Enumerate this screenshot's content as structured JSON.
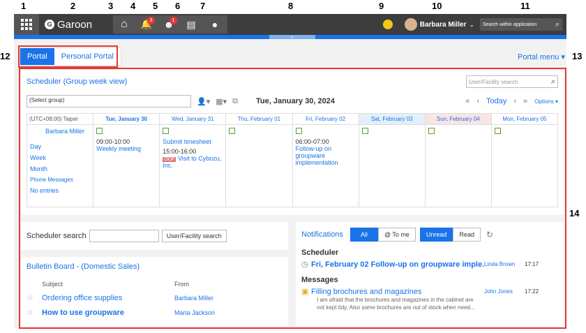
{
  "callouts": [
    "1",
    "2",
    "3",
    "4",
    "5",
    "6",
    "7",
    "8",
    "9",
    "10",
    "11",
    "12",
    "13",
    "14"
  ],
  "topbar": {
    "logo": "Garoon",
    "notify_badge": "3",
    "presence_badge": "1",
    "user_name": "Barbara Miller",
    "search_label": "Search within application"
  },
  "tabs": [
    {
      "label": "Portal"
    },
    {
      "label": "Personal Portal"
    }
  ],
  "portal_menu": "Portal menu",
  "scheduler": {
    "title": "Scheduler (Group week view)",
    "facility_placeholder": "User/Facility search",
    "group_select": "(Select group)",
    "date": "Tue, January 30, 2024",
    "today": "Today",
    "options": "Options",
    "timezone": "(UTC+08:00) Taipei",
    "days": [
      "Tue, January 30",
      "Wed, January 31",
      "Thu, February 01",
      "Fri, February 02",
      "Sat, February 03",
      "Sun, February 04",
      "Mon, February 05"
    ],
    "user": "Barbara Miller",
    "views": [
      "Day",
      "Week",
      "Month",
      "Phone Messages",
      "No entries"
    ],
    "ev1_time": "09:00-10:00",
    "ev1_title": "Weekly meeting",
    "ev2_title": "Submit timesheet",
    "ev3_time": "15:00-16:00",
    "ev3_badge": "OOF",
    "ev3_title": "Visit to Cybozu, Inc.",
    "ev4_time": "06:00-07:00",
    "ev4_title": "Follow-up on groupware implementation"
  },
  "sched_search": {
    "label": "Scheduler search",
    "button": "User/Facility search"
  },
  "bulletin": {
    "title": "Bulletin Board - (Domestic Sales)",
    "col_subject": "Subject",
    "col_from": "From",
    "rows": [
      {
        "subject": "Ordering office supplies",
        "from": "Barbara Miller"
      },
      {
        "subject": "How to use groupware",
        "from": "Maria Jackson"
      }
    ]
  },
  "notifications": {
    "title": "Notifications",
    "all": "All",
    "tome": "@ To me",
    "unread": "Unread",
    "read": "Read",
    "sec1": "Scheduler",
    "item1": "Fri, February 02 Follow-up on groupware imple...",
    "item1_from": "Linda Brown",
    "item1_time": "17:17",
    "sec2": "Messages",
    "item2": "Filling brochures and magazines",
    "item2_from": "John Jones",
    "item2_time": "17:22",
    "item2_body": "I am afraid that the brochures and magazines in the cabinet are not kept tidy. Also some brochures are out of stock when need..."
  }
}
